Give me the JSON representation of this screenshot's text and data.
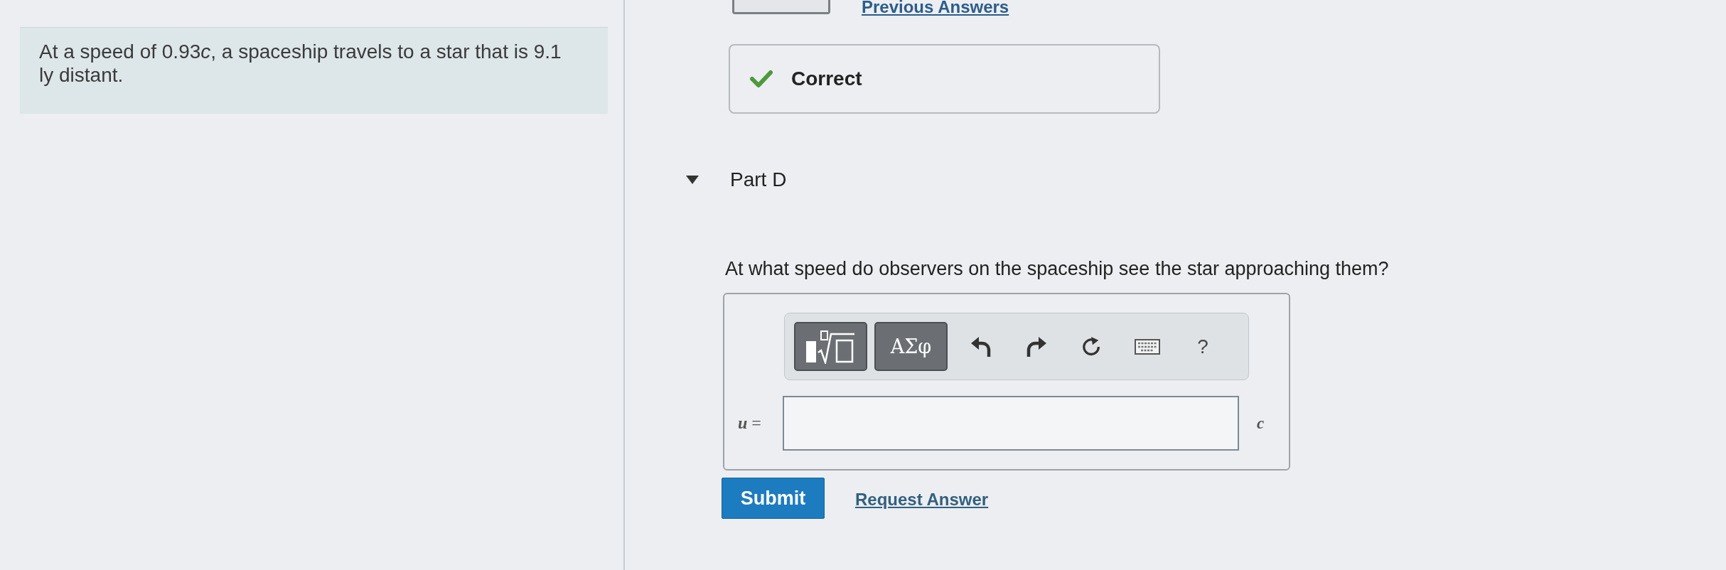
{
  "top_links": {
    "previous_answers": "Previous Answers"
  },
  "problem": {
    "segments": [
      {
        "text": "At a speed of 0.93",
        "italic": false
      },
      {
        "text": "c",
        "italic": true
      },
      {
        "text": ", a spaceship travels to a star that is 9.1 ly distant.",
        "italic": false
      }
    ]
  },
  "feedback": {
    "correct": true,
    "text": "Correct"
  },
  "part": {
    "label": "Part D",
    "expanded": true
  },
  "question": "At what speed do observers on the spaceship see the star approaching them?",
  "answer": {
    "toolbar": [
      {
        "kind": "templates"
      },
      {
        "kind": "symbols",
        "label": "ΑΣφ"
      },
      {
        "kind": "undo"
      },
      {
        "kind": "redo"
      },
      {
        "kind": "reset"
      },
      {
        "kind": "keyboard"
      },
      {
        "kind": "help",
        "label": "?"
      }
    ],
    "variable_label": "*u* =",
    "unit": "c"
  },
  "actions": [
    {
      "kind": "button",
      "label": "Submit"
    },
    {
      "kind": "link",
      "label": "Request Answer"
    }
  ]
}
